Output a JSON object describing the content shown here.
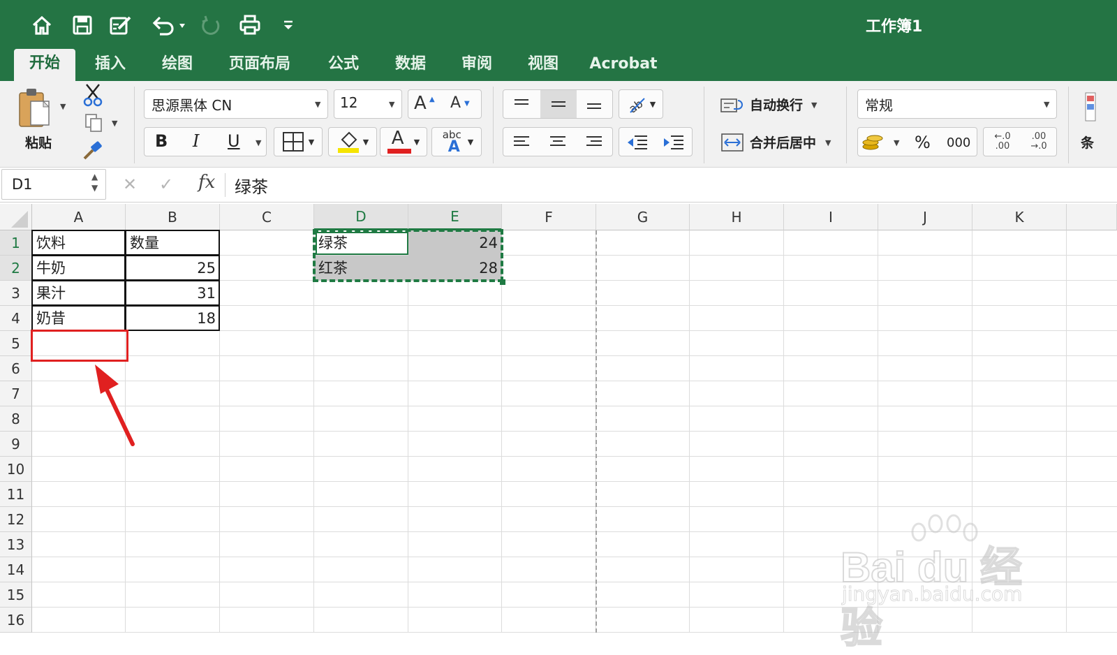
{
  "window": {
    "title": "工作簿1"
  },
  "quick_access": [
    "home-icon",
    "save-icon",
    "edit-icon",
    "undo-icon",
    "redo-icon",
    "print-icon",
    "customize-icon"
  ],
  "tabs": [
    "开始",
    "插入",
    "绘图",
    "页面布局",
    "公式",
    "数据",
    "审阅",
    "视图",
    "Acrobat"
  ],
  "ribbon": {
    "paste": "粘贴",
    "font_name": "思源黑体 CN",
    "font_size": "12",
    "increase_font": "A",
    "decrease_font": "A",
    "bold": "B",
    "italic": "I",
    "underline": "U",
    "font_color_glyph": "A",
    "phonetic_top": "abc",
    "phonetic_bottom": "A",
    "wrap_text": "自动换行",
    "merge_center": "合并后居中",
    "number_format": "常规",
    "percent": "%",
    "thousands": "000",
    "inc_dec_top": "←.0",
    "inc_dec_bottom": ".00",
    "dec_dec_top": ".00",
    "dec_dec_bottom": "→.0",
    "cond_format": "条",
    "fill_color": "#f5e400",
    "font_color": "#e02020"
  },
  "formula_bar": {
    "name_box": "D1",
    "cancel": "✕",
    "enter": "✓",
    "fx": "fx",
    "content": "绿茶"
  },
  "columns": [
    "A",
    "B",
    "C",
    "D",
    "E",
    "F",
    "G",
    "H",
    "I",
    "J",
    "K"
  ],
  "rows": [
    "1",
    "2",
    "3",
    "4",
    "5",
    "6",
    "7",
    "8",
    "9",
    "10",
    "11",
    "12",
    "13",
    "14",
    "15",
    "16"
  ],
  "cells": {
    "A1": "饮料",
    "B1": "数量",
    "A2": "牛奶",
    "B2": "25",
    "A3": "果汁",
    "B3": "31",
    "A4": "奶昔",
    "B4": "18",
    "D1": "绿茶",
    "E1": "24",
    "D2": "红茶",
    "E2": "28"
  },
  "selection": {
    "active_cell": "D1",
    "copied_range": "D1:E2",
    "highlighted_cell": "A5"
  },
  "watermark": {
    "brand": "Bai du 经验",
    "url": "jingyan.baidu.com"
  },
  "colors": {
    "brand_green": "#247444",
    "selection_green": "#1f7a43",
    "annotation_red": "#e02020",
    "selected_fill": "#c8c8c8"
  }
}
